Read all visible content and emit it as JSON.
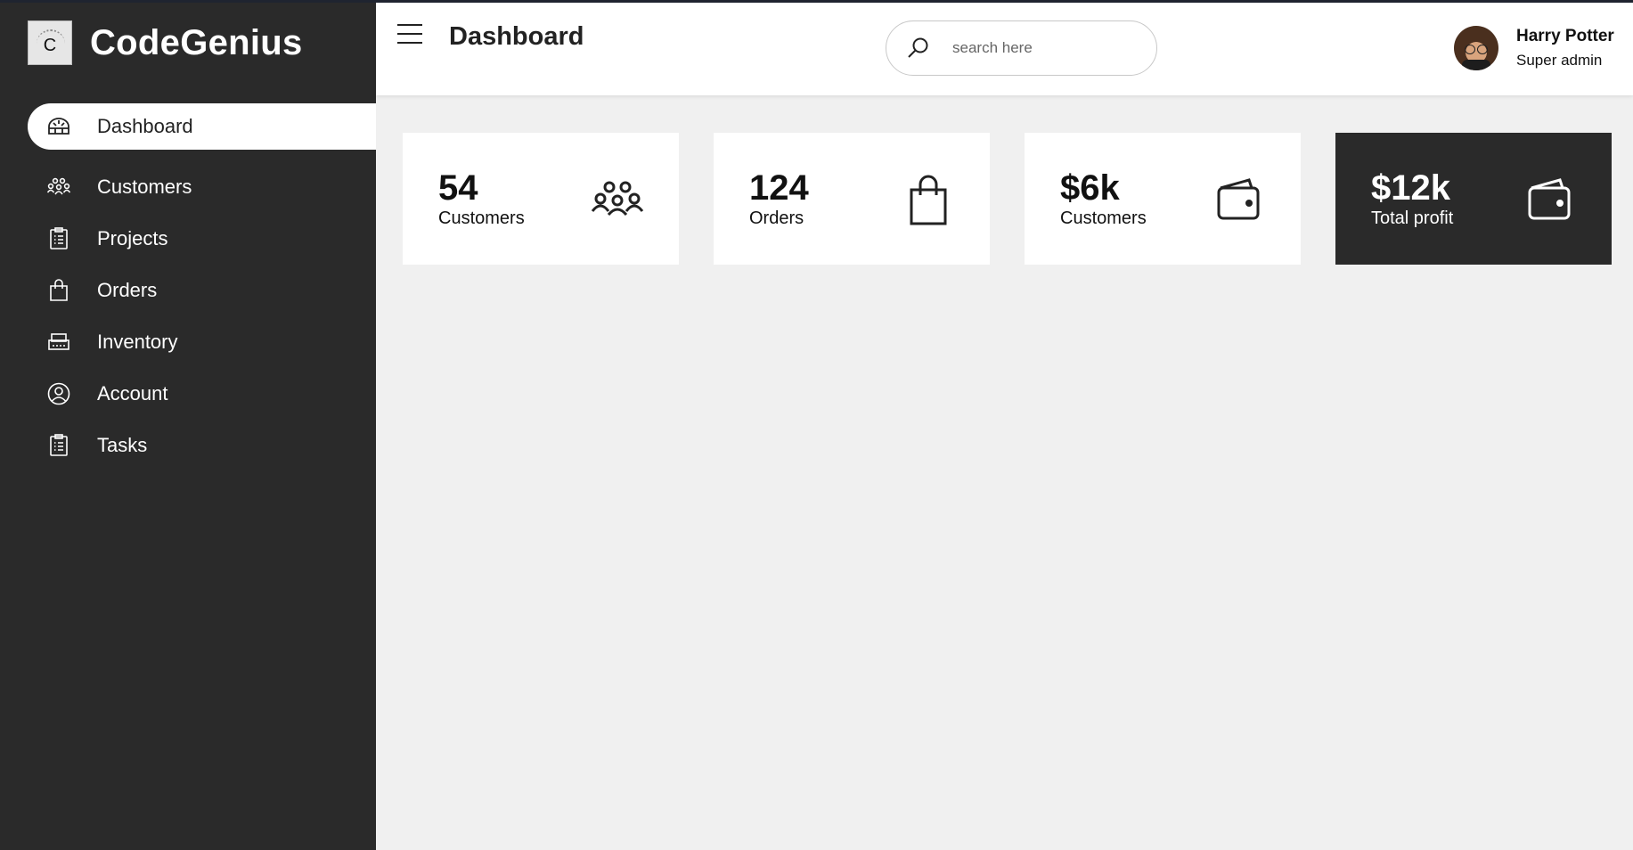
{
  "brand": {
    "name": "CodeGenius",
    "logo_letter": "C"
  },
  "sidebar": {
    "items": [
      {
        "label": "Dashboard",
        "icon": "dashboard-icon",
        "active": true
      },
      {
        "label": "Customers",
        "icon": "people-icon",
        "active": false
      },
      {
        "label": "Projects",
        "icon": "clipboard-icon",
        "active": false
      },
      {
        "label": "Orders",
        "icon": "bag-icon",
        "active": false
      },
      {
        "label": "Inventory",
        "icon": "inventory-icon",
        "active": false
      },
      {
        "label": "Account",
        "icon": "user-circle-icon",
        "active": false
      },
      {
        "label": "Tasks",
        "icon": "clipboard-icon",
        "active": false
      }
    ]
  },
  "header": {
    "title": "Dashboard",
    "search": {
      "placeholder": "search here",
      "value": ""
    },
    "user": {
      "name": "Harry Potter",
      "role": "Super admin"
    }
  },
  "cards": [
    {
      "value": "54",
      "label": "Customers",
      "icon": "people-icon"
    },
    {
      "value": "124",
      "label": "Orders",
      "icon": "bag-icon"
    },
    {
      "value": "$6k",
      "label": "Customers",
      "icon": "wallet-icon"
    },
    {
      "value": "$12k",
      "label": "Total profit",
      "icon": "wallet-icon"
    }
  ],
  "colors": {
    "sidebar": "#2a2a2a",
    "background": "#f0f0f0",
    "card": "#ffffff",
    "card_dark": "#2a2a2a"
  }
}
